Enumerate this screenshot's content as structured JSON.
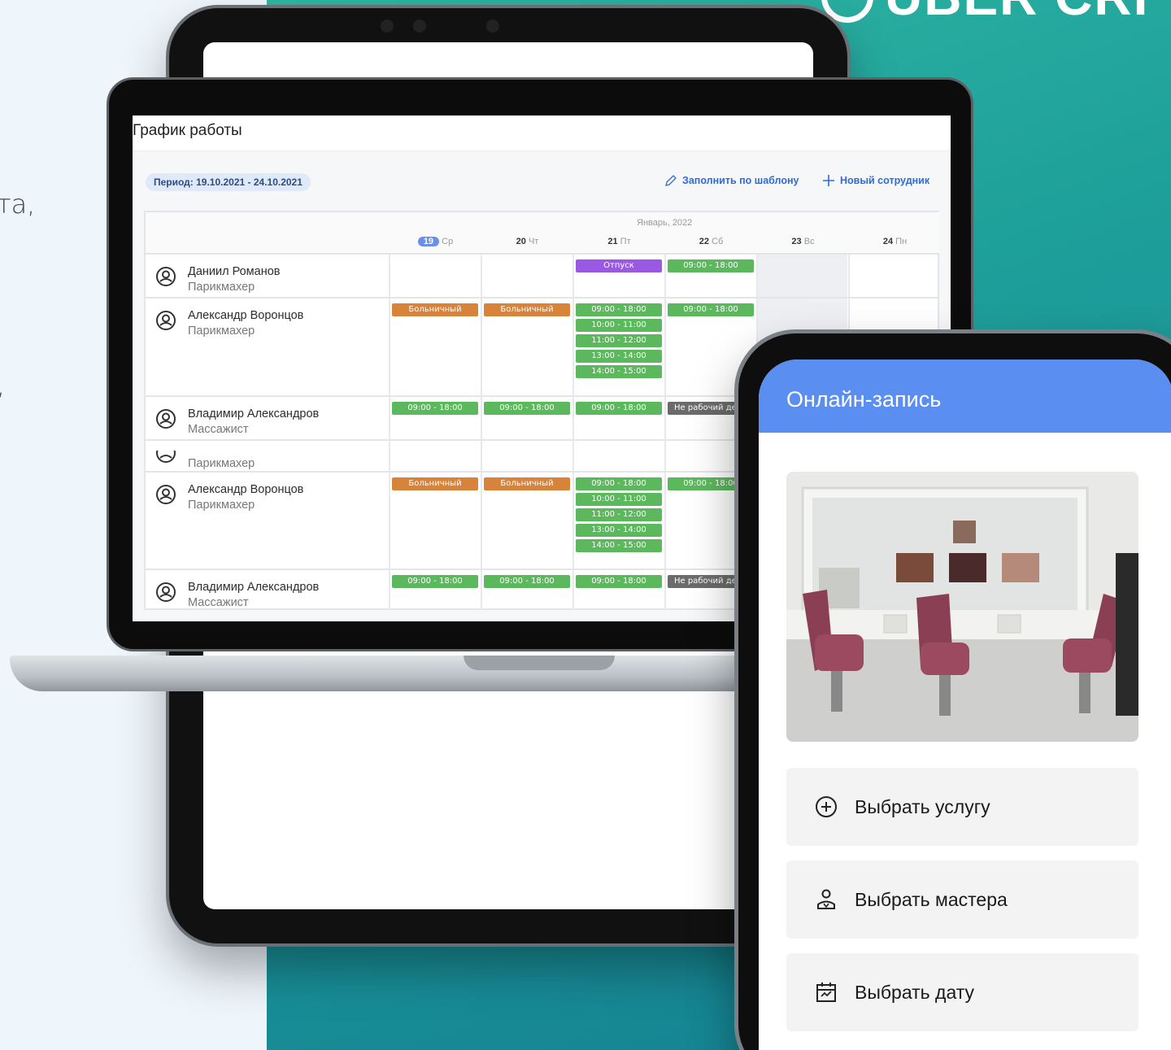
{
  "side_fragments": [
    "та,",
    ","
  ],
  "brand": {
    "logo_text": "UBER CRI"
  },
  "schedule": {
    "title": "График работы",
    "period": "Период: 19.10.2021 - 24.10.2021",
    "actions": {
      "fill_template": "Заполнить по шаблону",
      "new_employee": "Новый сотрудник"
    },
    "month": "Январь, 2022",
    "days": [
      {
        "num": "19",
        "dow": "Ср",
        "today": true
      },
      {
        "num": "20",
        "dow": "Чт"
      },
      {
        "num": "21",
        "dow": "Пт"
      },
      {
        "num": "22",
        "dow": "Сб"
      },
      {
        "num": "23",
        "dow": "Вс"
      },
      {
        "num": "24",
        "dow": "Пн"
      }
    ],
    "employees": [
      {
        "name": "Даниил Романов",
        "role": "Парикмахер"
      },
      {
        "name": "Александр Воронцов",
        "role": "Парикмахер"
      },
      {
        "name": "Владимир Александров",
        "role": "Массажист"
      },
      {
        "name": "",
        "role": "Парикмахер"
      },
      {
        "name": "Александр Воронцов",
        "role": "Парикмахер"
      },
      {
        "name": "Владимир Александров",
        "role": "Массажист"
      }
    ],
    "labels": {
      "vacation": "Отпуск",
      "sick": "Больничный",
      "day_off": "Не рабочий день",
      "full_day": "09:00 - 18:00",
      "slots": [
        "09:00 - 18:00",
        "10:00 - 11:00",
        "11:00 - 12:00",
        "13:00 - 14:00",
        "14:00 - 15:00"
      ]
    }
  },
  "phone": {
    "title": "Онлайн-запись",
    "buttons": [
      "Выбрать услугу",
      "Выбрать мастера",
      "Выбрать дату"
    ]
  }
}
